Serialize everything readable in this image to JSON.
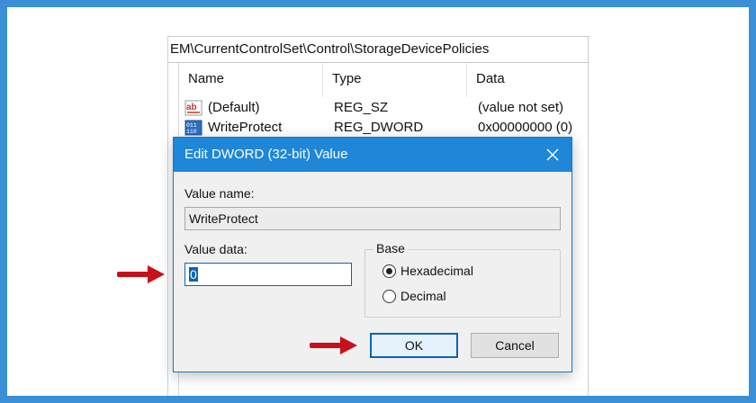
{
  "window": {
    "address_path": "EM\\CurrentControlSet\\Control\\StorageDevicePolicies"
  },
  "list": {
    "columns": [
      "Name",
      "Type",
      "Data"
    ],
    "rows": [
      {
        "icon": "string-value-icon",
        "name": "(Default)",
        "type": "REG_SZ",
        "data": "(value not set)"
      },
      {
        "icon": "binary-value-icon",
        "name": "WriteProtect",
        "type": "REG_DWORD",
        "data": "0x00000000 (0)"
      }
    ]
  },
  "dialog": {
    "title": "Edit DWORD (32-bit) Value",
    "value_name_label": "Value name:",
    "value_name": "WriteProtect",
    "value_data_label": "Value data:",
    "value_data": "0",
    "base": {
      "label": "Base",
      "options": [
        "Hexadecimal",
        "Decimal"
      ],
      "selected": "Hexadecimal"
    },
    "ok_label": "OK",
    "cancel_label": "Cancel"
  },
  "colors": {
    "frame": "#3a8fd6",
    "titlebar": "#1f86d8",
    "accent": "#0a64b4",
    "arrow": "#c8101a"
  }
}
